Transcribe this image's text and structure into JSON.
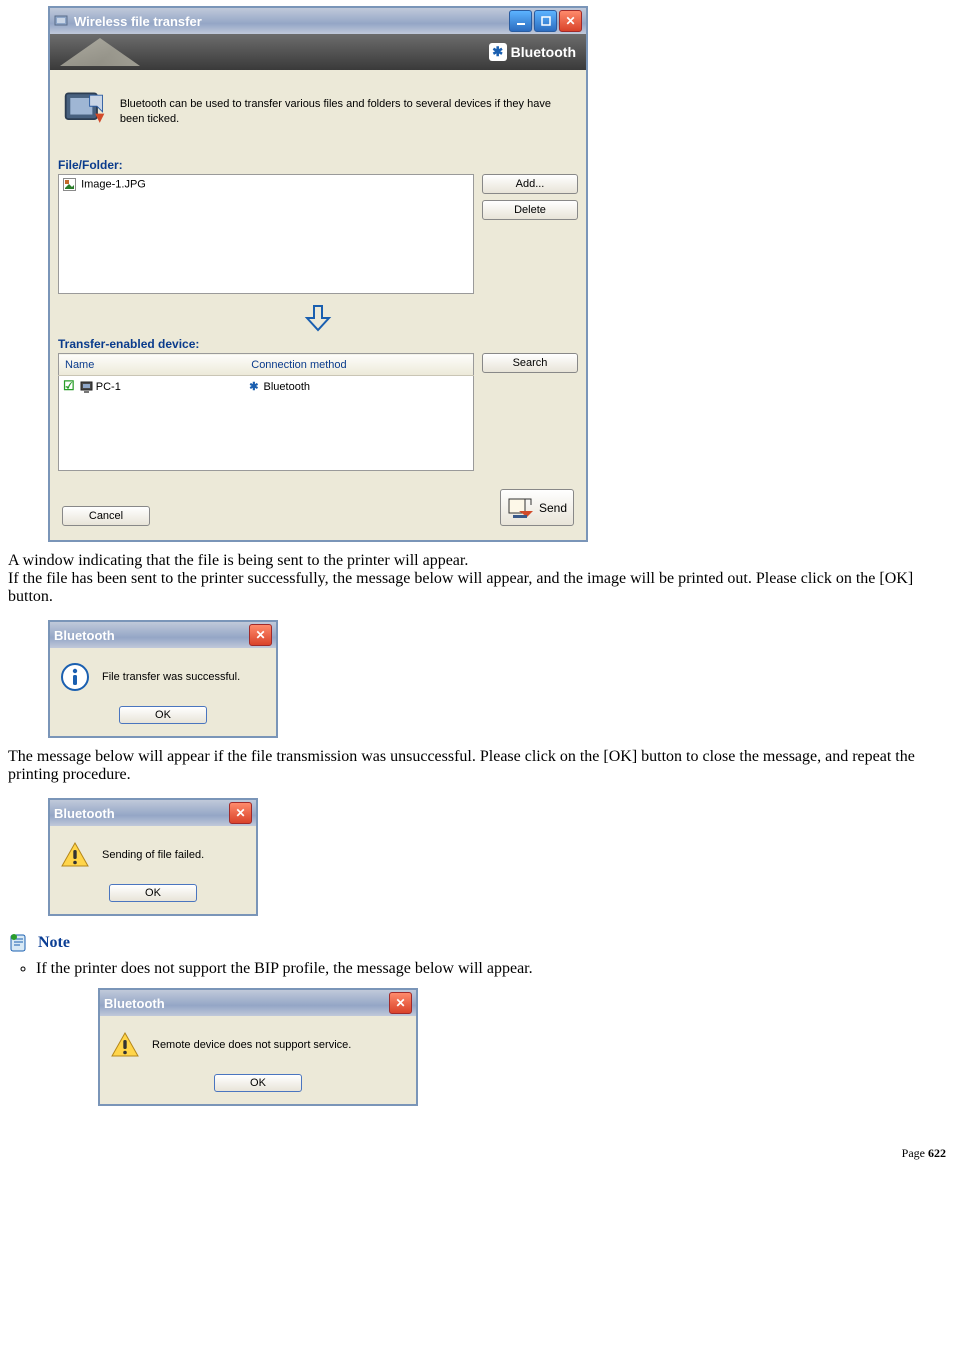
{
  "main_window": {
    "title": "Wireless file transfer",
    "banner_label": "Bluetooth",
    "intro_text": "Bluetooth can be used to transfer various files and folders to several devices if they have been ticked.",
    "file_folder_label": "File/Folder:",
    "file_items": [
      "Image-1.JPG"
    ],
    "add_btn": "Add...",
    "delete_btn": "Delete",
    "transfer_label": "Transfer-enabled device:",
    "col_name": "Name",
    "col_conn": "Connection method",
    "device_name": "PC-1",
    "device_conn": "Bluetooth",
    "search_btn": "Search",
    "cancel_btn": "Cancel",
    "send_btn": "Send"
  },
  "para1": "A window indicating that the file is being sent to the printer will appear.",
  "para2": "If the file has been sent to the printer successfully, the message below will appear, and the image will be printed out. Please click on the [OK] button.",
  "dlg_success": {
    "title": "Bluetooth",
    "msg": "File transfer was successful.",
    "ok": "OK"
  },
  "para3": "The message below will appear if the file transmission was unsuccessful. Please click on the [OK] button to close the message, and repeat the printing procedure.",
  "dlg_fail": {
    "title": "Bluetooth",
    "msg": "Sending of file failed.",
    "ok": "OK"
  },
  "note_label": "Note",
  "note_item": "If the printer does not support the BIP profile, the message below will appear.",
  "dlg_bip": {
    "title": "Bluetooth",
    "msg": "Remote device does not support service.",
    "ok": "OK"
  },
  "page_label": "Page",
  "page_number": "622"
}
